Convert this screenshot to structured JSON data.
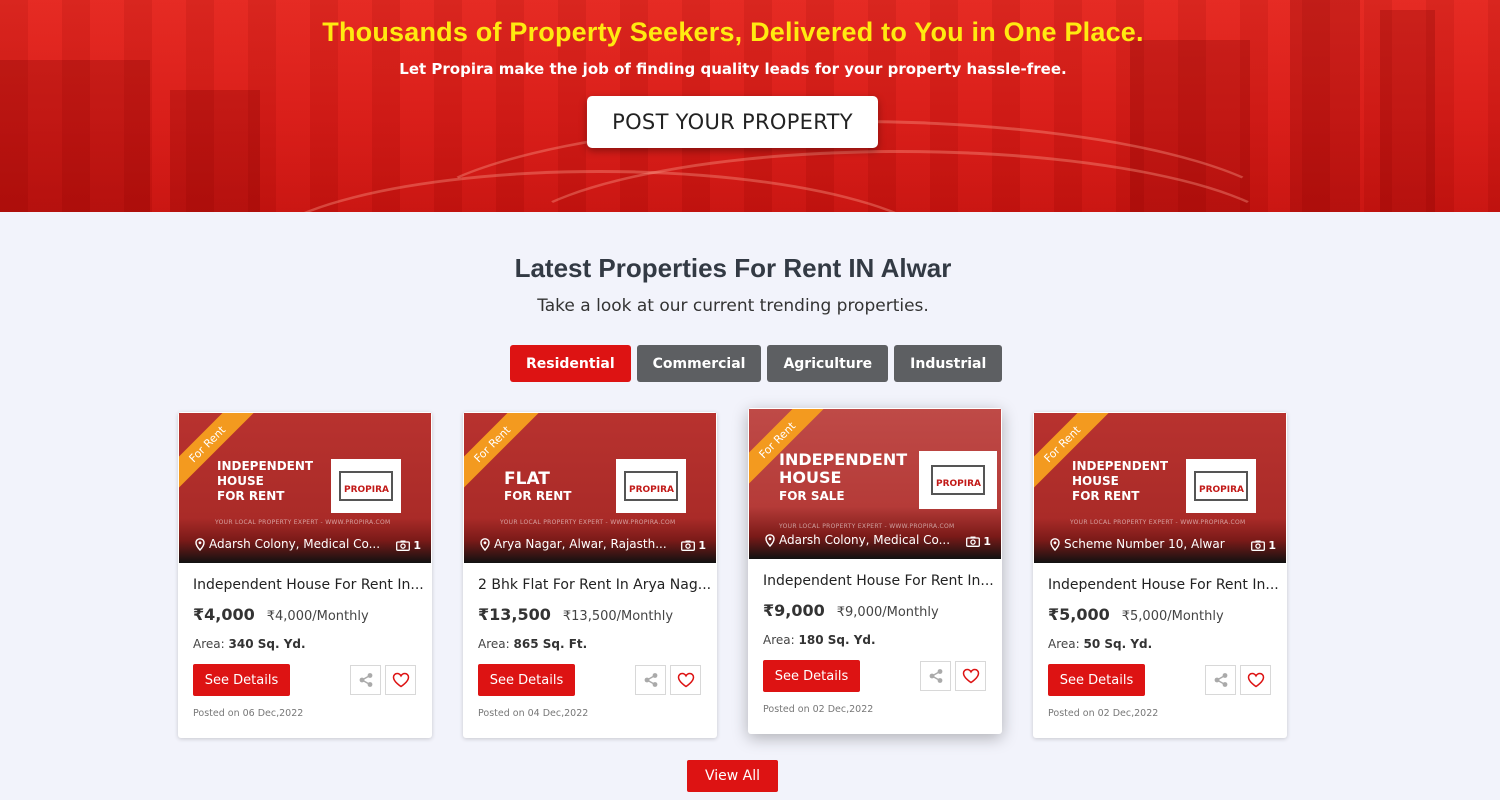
{
  "hero": {
    "title": "Thousands of Property Seekers, Delivered to You in One Place.",
    "subtitle": "Let Propira make the job of finding quality leads for your property hassle-free.",
    "cta_label": "POST YOUR PROPERTY"
  },
  "section": {
    "title": "Latest Properties For Rent IN Alwar",
    "subtitle": "Take a look at our current trending properties."
  },
  "tabs": [
    {
      "label": "Residential",
      "active": true
    },
    {
      "label": "Commercial",
      "active": false
    },
    {
      "label": "Agriculture",
      "active": false
    },
    {
      "label": "Industrial",
      "active": false
    }
  ],
  "cards": [
    {
      "ribbon": "For Rent",
      "thumb_line1": "INDEPENDENT",
      "thumb_line2": "HOUSE",
      "thumb_line3": "FOR RENT",
      "logo_text": "PROPIRA",
      "tagline": "YOUR LOCAL PROPERTY EXPERT - WWW.PROPIRA.COM",
      "location": "Adarsh Colony, Medical Co...",
      "photo_count": "1",
      "title": "Independent House For Rent In...",
      "price": "₹4,000",
      "price_monthly": "₹4,000/Monthly",
      "area_label": "Area:",
      "area_value": "340 Sq. Yd.",
      "details_label": "See Details",
      "posted": "Posted on 06 Dec,2022"
    },
    {
      "ribbon": "For Rent",
      "thumb_line1": "FLAT",
      "thumb_line2": "FOR RENT",
      "thumb_line3": "",
      "logo_text": "PROPIRA",
      "tagline": "YOUR LOCAL PROPERTY EXPERT - WWW.PROPIRA.COM",
      "location": "Arya Nagar, Alwar, Rajasth...",
      "photo_count": "1",
      "title": "2 Bhk Flat For Rent In Arya Nag...",
      "price": "₹13,500",
      "price_monthly": "₹13,500/Monthly",
      "area_label": "Area:",
      "area_value": "865 Sq. Ft.",
      "details_label": "See Details",
      "posted": "Posted on 04 Dec,2022"
    },
    {
      "ribbon": "For Rent",
      "thumb_line1": "INDEPENDENT",
      "thumb_line2": "HOUSE",
      "thumb_line3": "FOR SALE",
      "logo_text": "PROPIRA",
      "tagline": "YOUR LOCAL PROPERTY EXPERT - WWW.PROPIRA.COM",
      "location": "Adarsh Colony, Medical Co...",
      "photo_count": "1",
      "title": "Independent House For Rent In...",
      "price": "₹9,000",
      "price_monthly": "₹9,000/Monthly",
      "area_label": "Area:",
      "area_value": "180 Sq. Yd.",
      "details_label": "See Details",
      "posted": "Posted on 02 Dec,2022"
    },
    {
      "ribbon": "For Rent",
      "thumb_line1": "INDEPENDENT",
      "thumb_line2": "HOUSE",
      "thumb_line3": "FOR RENT",
      "logo_text": "PROPIRA",
      "tagline": "YOUR LOCAL PROPERTY EXPERT - WWW.PROPIRA.COM",
      "location": "Scheme Number 10, Alwar",
      "photo_count": "1",
      "title": "Independent House For Rent In...",
      "price": "₹5,000",
      "price_monthly": "₹5,000/Monthly",
      "area_label": "Area:",
      "area_value": "50 Sq. Yd.",
      "details_label": "See Details",
      "posted": "Posted on 02 Dec,2022"
    }
  ],
  "view_all_label": "View All",
  "icons": {
    "location": "map-pin-icon",
    "camera": "camera-icon",
    "share": "share-icon",
    "heart": "heart-icon"
  },
  "colors": {
    "accent": "#dd1313",
    "hero_title": "#ffea10",
    "tab_inactive": "#5d5f62",
    "ribbon": "#f39a1f"
  }
}
